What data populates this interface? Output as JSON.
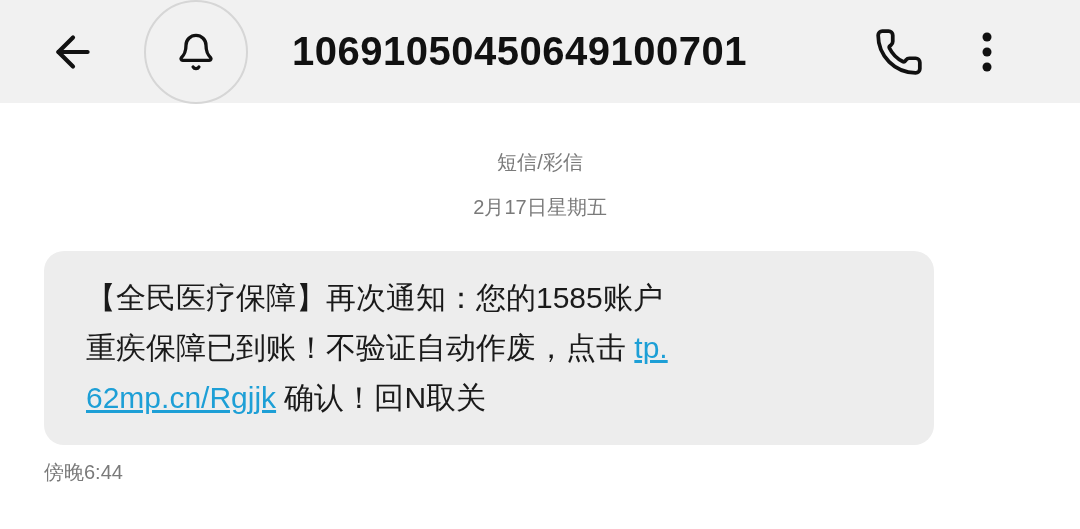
{
  "header": {
    "title": "10691050450649100701"
  },
  "conversation": {
    "type_label": "短信/彩信",
    "date": "2月17日星期五"
  },
  "messages": [
    {
      "lines": [
        [
          {
            "kind": "text",
            "text": "【全民医疗保障】再次通知：您的1585账户"
          }
        ],
        [
          {
            "kind": "text",
            "text": "重疾保障已到账！不验证自动作废，点击 "
          },
          {
            "kind": "link",
            "text": "tp."
          }
        ],
        [
          {
            "kind": "link",
            "text": "62mp.cn/Rgjjk"
          },
          {
            "kind": "text",
            "text": " 确认！回N取关"
          }
        ]
      ],
      "time": "傍晚6:44"
    }
  ]
}
